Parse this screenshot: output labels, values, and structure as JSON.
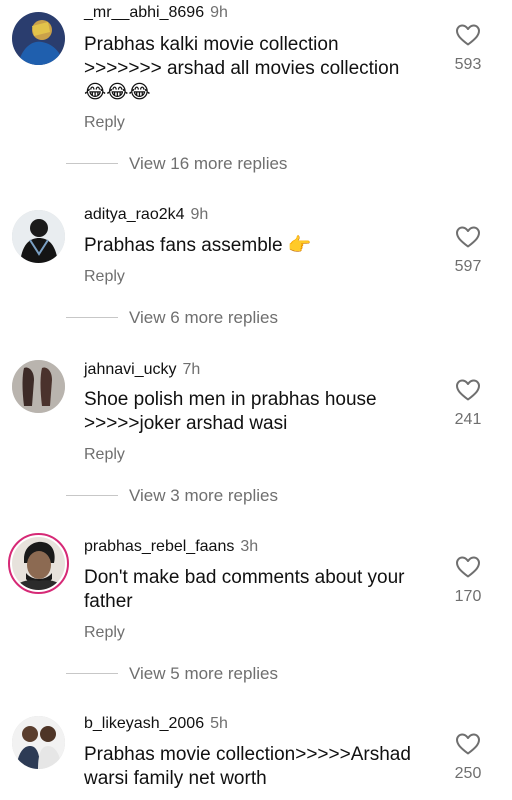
{
  "comments": [
    {
      "username": "_mr__abhi_8696",
      "time": "9h",
      "text_lines": [
        "Prabhas kalki movie collection",
        ">>>>>>> arshad all movies collection"
      ],
      "emojis": "😂😂😂",
      "reply_label": "Reply",
      "view_more": "View 16 more replies",
      "likes": "593",
      "avatar_icon": "user-avatar-icon"
    },
    {
      "username": "aditya_rao2k4",
      "time": "9h",
      "text_lines": [
        "Prabhas fans assemble 👉"
      ],
      "reply_label": "Reply",
      "view_more": "View 6 more replies",
      "likes": "597",
      "avatar_icon": "user-avatar-icon"
    },
    {
      "username": "jahnavi_ucky",
      "time": "7h",
      "text_lines": [
        "Shoe polish men in prabhas house",
        ">>>>>joker arshad wasi"
      ],
      "reply_label": "Reply",
      "view_more": "View 3 more replies",
      "likes": "241",
      "avatar_icon": "user-avatar-icon"
    },
    {
      "username": "prabhas_rebel_faans",
      "time": "3h",
      "text_lines": [
        "Don't make bad comments about your",
        "father"
      ],
      "reply_label": "Reply",
      "view_more": "View 5 more replies",
      "likes": "170",
      "avatar_icon": "user-avatar-icon"
    },
    {
      "username": "b_likeyash_2006",
      "time": "5h",
      "text_lines": [
        "Prabhas movie collection>>>>>Arshad",
        "warsi family net worth"
      ],
      "likes": "250",
      "avatar_icon": "user-avatar-icon"
    }
  ],
  "icons": {
    "like": "heart-outline-icon"
  },
  "colors": {
    "muted_text": "#6f6f6f",
    "story_ring": "#d62976"
  }
}
